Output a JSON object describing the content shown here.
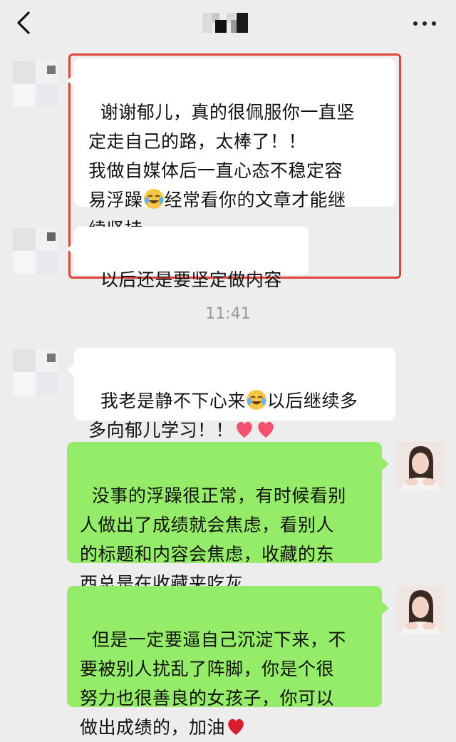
{
  "header": {
    "title": ""
  },
  "messages": [
    {
      "side": "left",
      "text1": "谢谢郁儿，真的很佩服你一直坚\n定走自己的路，太棒了！！\n我做自媒体后一直心态不稳定容\n易浮躁",
      "emoji": "crying-laughing-emoji",
      "text2": "经常看你的文章才能继\n续坚持"
    },
    {
      "side": "left",
      "text": "以后还是要坚定做内容"
    },
    {
      "side": "left",
      "text1": "我老是静不下心来",
      "emoji": "crying-laughing-emoji",
      "text2": "以后继续多\n多向郁儿学习！！",
      "hearts": "two-hearts-emoji"
    },
    {
      "side": "right",
      "text": "没事的浮躁很正常，有时候看别\n人做出了成绩就会焦虑，看别人\n的标题和内容会焦虑，收藏的东\n西总是在收藏夹吃灰"
    },
    {
      "side": "right",
      "text": "但是一定要逼自己沉淀下来，不\n要被别人扰乱了阵脚，你是个很\n努力也很善良的女孩子，你可以\n做出成绩的，加油",
      "emoji": "red-heart-emoji"
    }
  ],
  "timestamp": "11:41",
  "colors": {
    "background": "#ededed",
    "bubble_left": "#ffffff",
    "bubble_right": "#95ec69",
    "highlight_border": "#e0433a"
  }
}
